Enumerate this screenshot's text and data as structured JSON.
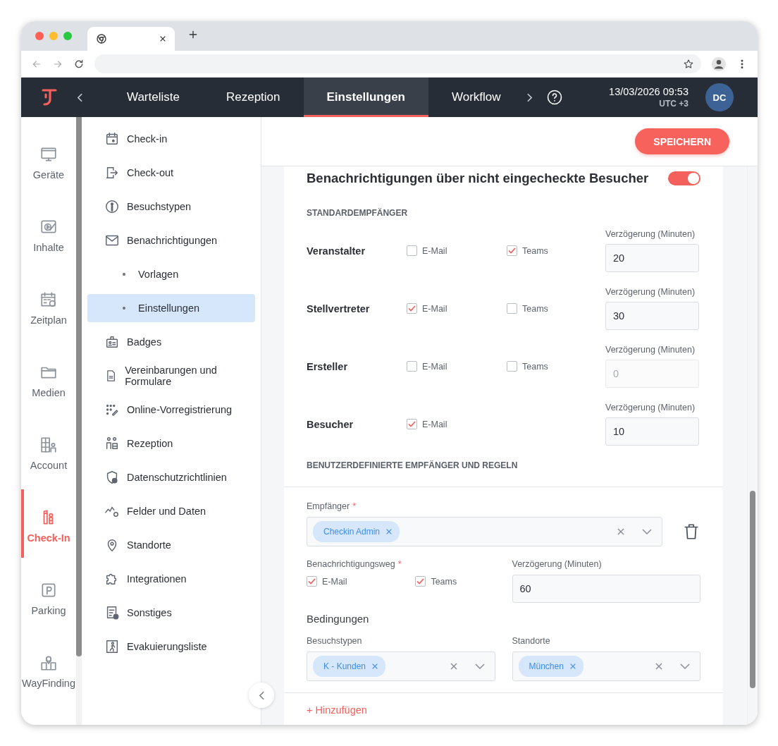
{
  "header": {
    "tabs": [
      {
        "label": "Warteliste",
        "selected": false
      },
      {
        "label": "Rezeption",
        "selected": false
      },
      {
        "label": "Einstellungen",
        "selected": true
      },
      {
        "label": "Workflow",
        "selected": false
      }
    ],
    "datetime": "13/03/2026 09:53",
    "timezone": "UTC +3",
    "avatar": "DC"
  },
  "rail": {
    "items": [
      {
        "label": "Geräte",
        "selected": false
      },
      {
        "label": "Inhalte",
        "selected": false
      },
      {
        "label": "Zeitplan",
        "selected": false
      },
      {
        "label": "Medien",
        "selected": false
      },
      {
        "label": "Account",
        "selected": false
      },
      {
        "label": "Check-In",
        "selected": true
      },
      {
        "label": "Parking",
        "selected": false
      },
      {
        "label": "WayFinding",
        "selected": false
      }
    ]
  },
  "submenu": {
    "items": [
      {
        "label": "Check-in",
        "selected": false
      },
      {
        "label": "Check-out",
        "selected": false
      },
      {
        "label": "Besuchstypen",
        "selected": false
      },
      {
        "label": "Benachrichtigungen",
        "selected": false,
        "children": [
          {
            "label": "Vorlagen",
            "selected": false
          },
          {
            "label": "Einstellungen",
            "selected": true
          }
        ]
      },
      {
        "label": "Badges",
        "selected": false
      },
      {
        "label": "Vereinbarungen und Formulare",
        "selected": false
      },
      {
        "label": "Online-Vorregistrierung",
        "selected": false
      },
      {
        "label": "Rezeption",
        "selected": false
      },
      {
        "label": "Datenschutzrichtlinien",
        "selected": false
      },
      {
        "label": "Felder und Daten",
        "selected": false
      },
      {
        "label": "Standorte",
        "selected": false
      },
      {
        "label": "Integrationen",
        "selected": false
      },
      {
        "label": "Sonstiges",
        "selected": false
      },
      {
        "label": "Evakuierungsliste",
        "selected": false
      }
    ]
  },
  "save_button": "SPEICHERN",
  "section": {
    "title": "Benachrichtigungen über nicht eingecheckte Besucher",
    "on": true,
    "standard_heading": "STANDARDEMPFÄNGER",
    "recipients": [
      {
        "name": "Veranstalter",
        "channels": [
          {
            "label": "E-Mail",
            "checked": false
          },
          {
            "label": "Teams",
            "checked": true
          }
        ],
        "delay_label": "Verzögerung (Minuten)",
        "delay": "20",
        "disabled": false
      },
      {
        "name": "Stellvertreter",
        "channels": [
          {
            "label": "E-Mail",
            "checked": true
          },
          {
            "label": "Teams",
            "checked": false
          }
        ],
        "delay_label": "Verzögerung (Minuten)",
        "delay": "30",
        "disabled": false
      },
      {
        "name": "Ersteller",
        "channels": [
          {
            "label": "E-Mail",
            "checked": false
          },
          {
            "label": "Teams",
            "checked": false
          }
        ],
        "delay_label": "Verzögerung (Minuten)",
        "delay": "0",
        "disabled": true
      },
      {
        "name": "Besucher",
        "channels": [
          {
            "label": "E-Mail",
            "checked": true
          }
        ],
        "delay_label": "Verzögerung (Minuten)",
        "delay": "10",
        "disabled": false
      }
    ],
    "custom_heading": "BENUTZERDEFINIERTE EMPFÄNGER UND REGELN",
    "rule": {
      "recipient_label": "Empfänger",
      "recipient_mark": "*",
      "recipient_chips": [
        "Checkin Admin"
      ],
      "channel_label": "Benachrichtigungsweg",
      "channel_mark": "*",
      "channels": [
        {
          "label": "E-Mail",
          "checked": true
        },
        {
          "label": "Teams",
          "checked": true
        }
      ],
      "delay_label": "Verzögerung (Minuten)",
      "delay": "60",
      "conditions_heading": "Bedingungen",
      "conditions": [
        {
          "label": "Besuchstypen",
          "chips": [
            "K - Kunden"
          ]
        },
        {
          "label": "Standorte",
          "chips": [
            "München"
          ]
        }
      ]
    },
    "add_link": "+ Hinzufügen"
  }
}
